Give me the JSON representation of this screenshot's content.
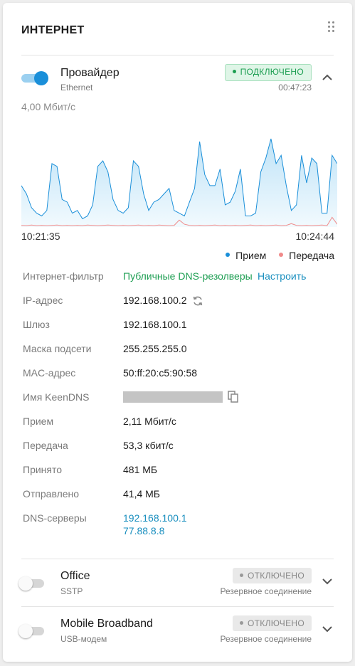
{
  "card": {
    "title": "ИНТЕРНЕТ"
  },
  "provider": {
    "name": "Провайдер",
    "type": "Ethernet",
    "status": "ПОДКЛЮЧЕНО",
    "uptime": "00:47:23",
    "enabled": true,
    "speed_label": "4,00 Мбит/с"
  },
  "chart_data": {
    "type": "area",
    "y_max_label": "4,00 Мбит/с",
    "ylim": [
      0,
      4.0
    ],
    "x_start_label": "10:21:35",
    "x_end_label": "10:24:44",
    "series": [
      {
        "name": "Прием",
        "color": "#1a8fd9",
        "values": [
          1.5,
          1.2,
          0.7,
          0.5,
          0.4,
          0.6,
          2.3,
          2.2,
          1.0,
          0.9,
          0.5,
          0.6,
          0.3,
          0.4,
          0.8,
          2.2,
          2.4,
          2.0,
          1.0,
          0.6,
          0.5,
          0.7,
          2.4,
          2.2,
          1.2,
          0.6,
          0.9,
          1.0,
          1.2,
          1.4,
          0.6,
          0.5,
          0.4,
          0.9,
          1.4,
          3.1,
          1.9,
          1.5,
          1.5,
          2.1,
          0.8,
          0.9,
          1.3,
          2.1,
          0.4,
          0.4,
          0.5,
          2.0,
          2.5,
          3.2,
          2.3,
          2.6,
          1.5,
          0.6,
          0.8,
          2.6,
          1.6,
          2.5,
          2.3,
          0.5,
          0.5,
          2.6,
          2.3
        ]
      },
      {
        "name": "Передача",
        "color": "#f08a8a",
        "values": [
          0.06,
          0.05,
          0.07,
          0.05,
          0.06,
          0.05,
          0.06,
          0.07,
          0.05,
          0.06,
          0.05,
          0.06,
          0.05,
          0.07,
          0.06,
          0.05,
          0.06,
          0.07,
          0.06,
          0.05,
          0.06,
          0.05,
          0.06,
          0.07,
          0.05,
          0.06,
          0.05,
          0.07,
          0.06,
          0.05,
          0.06,
          0.25,
          0.1,
          0.06,
          0.05,
          0.06,
          0.05,
          0.06,
          0.07,
          0.05,
          0.06,
          0.05,
          0.06,
          0.05,
          0.06,
          0.07,
          0.05,
          0.06,
          0.05,
          0.06,
          0.07,
          0.05,
          0.06,
          0.12,
          0.06,
          0.05,
          0.06,
          0.05,
          0.06,
          0.07,
          0.05,
          0.35,
          0.1
        ]
      }
    ],
    "legend_position": "bottom-right"
  },
  "legend": {
    "rx": "Прием",
    "tx": "Передача",
    "rx_color": "#1a8fd9",
    "tx_color": "#f08a8a"
  },
  "details": {
    "filter_label": "Интернет-фильтр",
    "filter_value": "Публичные DNS-резолверы",
    "filter_action": "Настроить",
    "ip_label": "IP-адрес",
    "ip_value": "192.168.100.2",
    "gateway_label": "Шлюз",
    "gateway_value": "192.168.100.1",
    "mask_label": "Маска подсети",
    "mask_value": "255.255.255.0",
    "mac_label": "MAC-адрес",
    "mac_value": "50:ff:20:c5:90:58",
    "keendns_label": "Имя KeenDNS",
    "rx_label": "Прием",
    "rx_value": "2,11 Мбит/с",
    "tx_label": "Передача",
    "tx_value": "53,3 кбит/с",
    "received_label": "Принято",
    "received_value": "481 МБ",
    "sent_label": "Отправлено",
    "sent_value": "41,4 МБ",
    "dns_label": "DNS-серверы",
    "dns_1": "192.168.100.1",
    "dns_2": "77.88.8.8"
  },
  "office": {
    "name": "Office",
    "type": "SSTP",
    "status": "ОТКЛЮЧЕНО",
    "role": "Резервное соединение",
    "enabled": false
  },
  "mobile": {
    "name": "Mobile Broadband",
    "type": "USB-модем",
    "status": "ОТКЛЮЧЕНО",
    "role": "Резервное соединение",
    "enabled": false
  },
  "colors": {
    "accent": "#1a8fd9",
    "status_ok": "#1d9e52",
    "link": "#1a8fbf",
    "tx_line": "#f08a8a"
  }
}
